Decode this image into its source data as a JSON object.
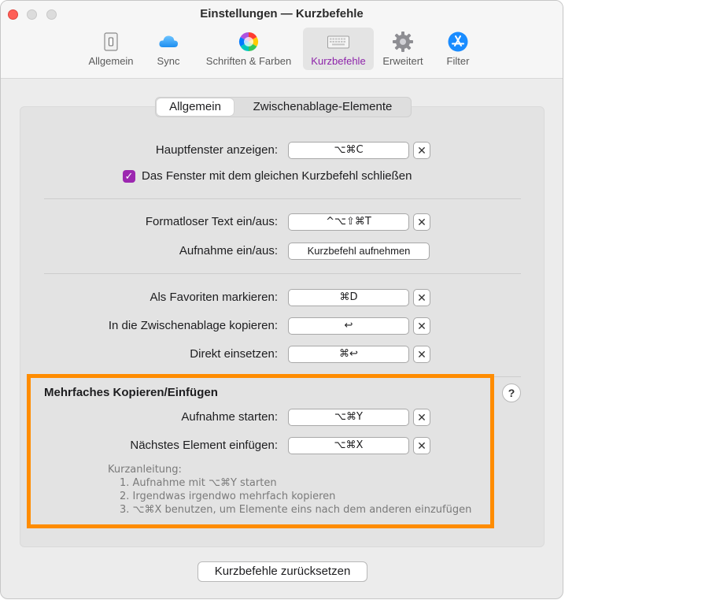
{
  "window": {
    "title": "Einstellungen — Kurzbefehle"
  },
  "toolbar": {
    "tabs": [
      {
        "label": "Allgemein",
        "icon": "switch-icon"
      },
      {
        "label": "Sync",
        "icon": "cloud-icon"
      },
      {
        "label": "Schriften & Farben",
        "icon": "color-wheel-icon"
      },
      {
        "label": "Kurzbefehle",
        "icon": "keyboard-icon",
        "active": true
      },
      {
        "label": "Erweitert",
        "icon": "gear-icon"
      },
      {
        "label": "Filter",
        "icon": "app-store-icon"
      }
    ]
  },
  "segmented": {
    "items": [
      "Allgemein",
      "Zwischenablage-Elemente"
    ],
    "selected": 0
  },
  "general": {
    "main_window_label": "Hauptfenster anzeigen:",
    "main_window_shortcut": "⌥⌘C",
    "close_checkbox_label": "Das Fenster mit dem gleichen Kurzbefehl schließen",
    "close_checkbox_checked": true
  },
  "plain_text": {
    "toggle_label": "Formatloser Text ein/aus:",
    "toggle_shortcut": "^⌥⇧⌘T",
    "record_label": "Aufnahme ein/aus:",
    "record_button": "Kurzbefehl aufnehmen"
  },
  "items": {
    "favorite_label": "Als Favoriten markieren:",
    "favorite_shortcut": "⌘D",
    "copy_label": "In die Zwischenablage kopieren:",
    "copy_shortcut": "↩",
    "paste_label": "Direkt einsetzen:",
    "paste_shortcut": "⌘↩"
  },
  "multi": {
    "title": "Mehrfaches Kopieren/Einfügen",
    "start_label": "Aufnahme starten:",
    "start_shortcut": "⌥⌘Y",
    "next_label": "Nächstes Element einfügen:",
    "next_shortcut": "⌥⌘X",
    "help_label": "?",
    "instructions_title": "Kurzanleitung:",
    "instructions": [
      "1. Aufnahme mit ⌥⌘Y starten",
      "2. Irgendwas irgendwo mehrfach kopieren",
      "3. ⌥⌘X benutzen, um Elemente eins nach dem anderen einzufügen"
    ]
  },
  "clear_label": "✕",
  "reset_button": "Kurzbefehle zurücksetzen",
  "colors": {
    "accent": "#9c27b0",
    "highlight": "#ff8c00",
    "close": "#fe5f57"
  }
}
